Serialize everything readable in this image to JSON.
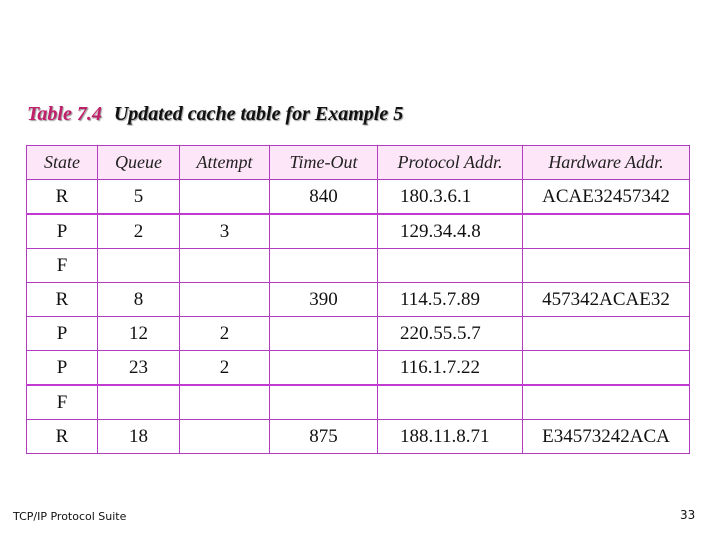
{
  "title": {
    "number": "Table 7.4",
    "caption": "Updated cache table for Example 5"
  },
  "table": {
    "headers": [
      "State",
      "Queue",
      "Attempt",
      "Time-Out",
      "Protocol Addr.",
      "Hardware Addr."
    ],
    "rows": [
      [
        "R",
        "5",
        "",
        "840",
        "180.3.6.1",
        "ACAE32457342"
      ],
      [
        "P",
        "2",
        "3",
        "",
        "129.34.4.8",
        ""
      ],
      [
        "F",
        "",
        "",
        "",
        "",
        ""
      ],
      [
        "R",
        "8",
        "",
        "390",
        "114.5.7.89",
        "457342ACAE32"
      ],
      [
        "P",
        "12",
        "2",
        "",
        "220.55.5.7",
        ""
      ],
      [
        "P",
        "23",
        "2",
        "",
        "116.1.7.22",
        ""
      ],
      [
        "F",
        "",
        "",
        "",
        "",
        ""
      ],
      [
        "R",
        "18",
        "",
        "875",
        "188.11.8.71",
        "E34573242ACA"
      ]
    ]
  },
  "footer": {
    "left": "TCP/IP Protocol Suite",
    "page": "33"
  },
  "colors": {
    "border": "#b13cc0",
    "header_bg": "#fde6f8",
    "title_number": "#c0206a"
  }
}
